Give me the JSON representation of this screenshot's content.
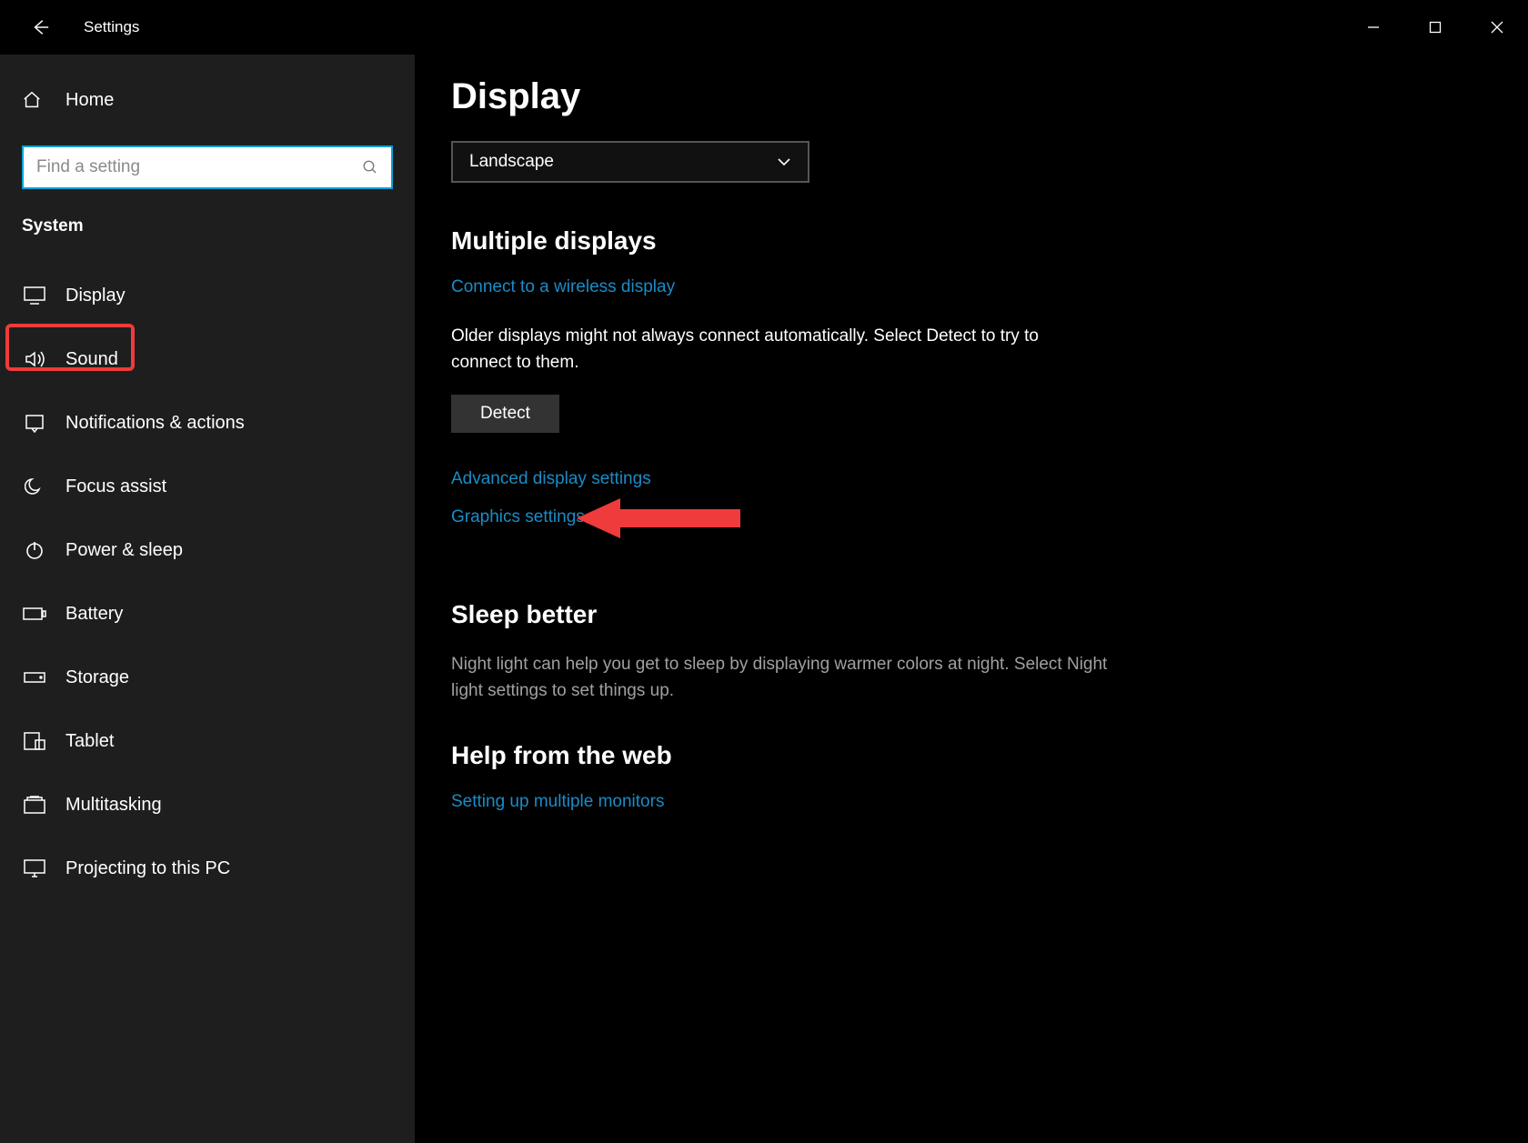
{
  "titlebar": {
    "title": "Settings"
  },
  "sidebar": {
    "home_label": "Home",
    "search_placeholder": "Find a setting",
    "section_label": "System",
    "items": [
      {
        "label": "Display"
      },
      {
        "label": "Sound"
      },
      {
        "label": "Notifications & actions"
      },
      {
        "label": "Focus assist"
      },
      {
        "label": "Power & sleep"
      },
      {
        "label": "Battery"
      },
      {
        "label": "Storage"
      },
      {
        "label": "Tablet"
      },
      {
        "label": "Multitasking"
      },
      {
        "label": "Projecting to this PC"
      }
    ]
  },
  "main": {
    "page_title": "Display",
    "orientation_selected": "Landscape",
    "section_multiple": "Multiple displays",
    "link_wireless": "Connect to a wireless display",
    "detect_desc": "Older displays might not always connect automatically. Select Detect to try to connect to them.",
    "detect_btn": "Detect",
    "link_advanced": "Advanced display settings",
    "link_graphics": "Graphics settings",
    "section_sleep": "Sleep better",
    "sleep_desc": "Night light can help you get to sleep by displaying warmer colors at night. Select Night light settings to set things up.",
    "section_help": "Help from the web",
    "link_help_monitors": "Setting up multiple monitors"
  }
}
